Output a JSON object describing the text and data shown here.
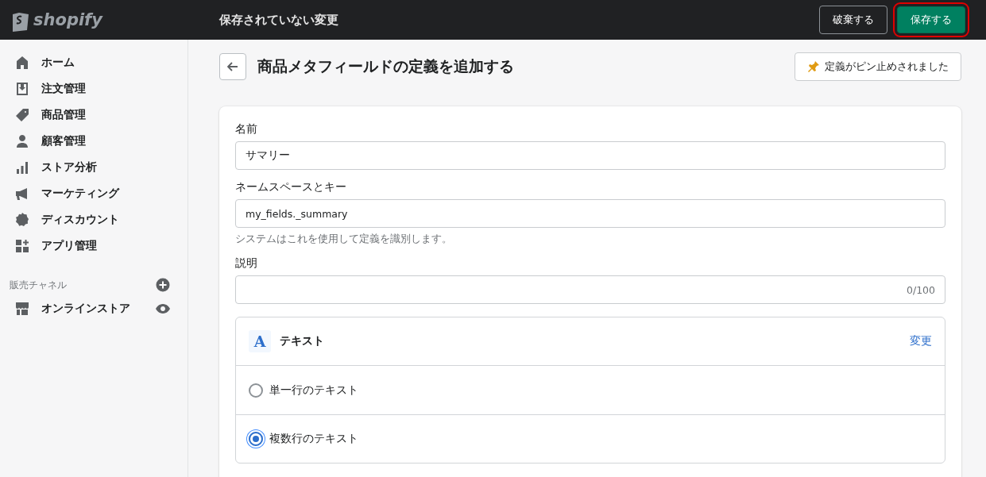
{
  "topbar": {
    "logo": "shopify",
    "title": "保存されていない変更",
    "buttons": [
      {
        "label": "破棄する",
        "kind": "secondary"
      },
      {
        "label": "保存する",
        "kind": "primary"
      }
    ]
  },
  "sidebar": {
    "items": [
      {
        "label": "ホーム",
        "kind": "home"
      },
      {
        "label": "注文管理",
        "kind": "orders"
      },
      {
        "label": "商品管理",
        "kind": "products"
      },
      {
        "label": "顧客管理",
        "kind": "customers"
      },
      {
        "label": "ストア分析",
        "kind": "analytics"
      },
      {
        "label": "マーケティング",
        "kind": "marketing"
      },
      {
        "label": "ディスカウント",
        "kind": "discounts"
      },
      {
        "label": "アプリ管理",
        "kind": "apps"
      }
    ],
    "section": {
      "title": "販売チャネル",
      "items": [
        {
          "label": "オンラインストア"
        }
      ]
    }
  },
  "page": {
    "title": "商品メタフィールドの定義を追加する",
    "pin_button": "定義がピン止めされました"
  },
  "form": {
    "name": {
      "label": "名前",
      "value": "サマリー"
    },
    "key": {
      "label": "ネームスペースとキー",
      "value": "my_fields._summary",
      "help": "システムはこれを使用して定義を識別します。"
    },
    "description": {
      "label": "説明",
      "counter": "0/100"
    },
    "type": {
      "badge": "A",
      "name": "テキスト",
      "change": "変更",
      "options": [
        {
          "label": "単一行のテキスト",
          "selected": false
        },
        {
          "label": "複数行のテキスト",
          "selected": true
        }
      ]
    }
  }
}
